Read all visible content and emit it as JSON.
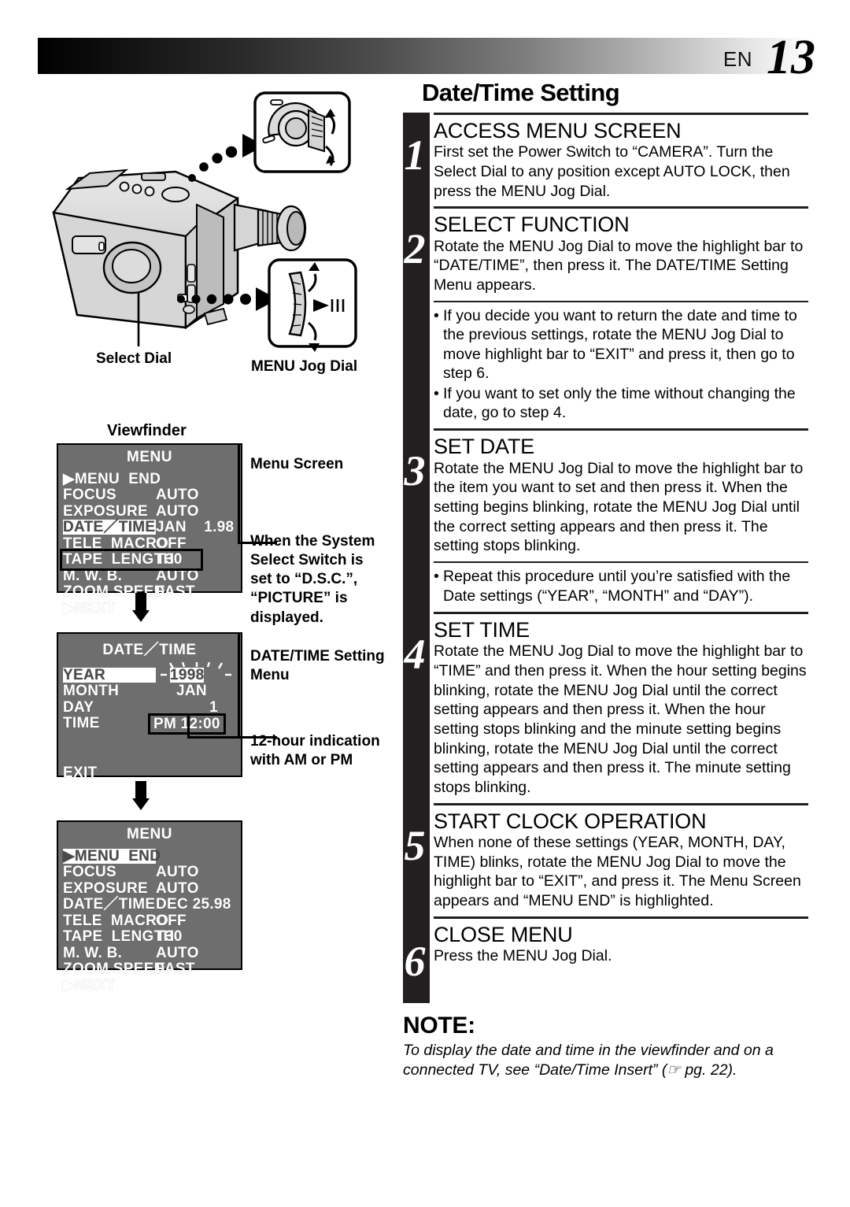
{
  "header": {
    "lang": "EN",
    "page_number": "13"
  },
  "page_title": "Date/Time Setting",
  "camera_labels": {
    "select_dial": "Select Dial",
    "menu_jog_dial": "MENU Jog Dial",
    "viewfinder": "Viewfinder"
  },
  "screens": {
    "menu_screen_1": {
      "caption": "MENU",
      "rows": [
        {
          "key": "▶MENU  END",
          "value": ""
        },
        {
          "key": "FOCUS",
          "value": "AUTO"
        },
        {
          "key": "EXPOSURE",
          "value": "AUTO"
        },
        {
          "key": "DATE／TIME",
          "value": "JAN    1.98"
        },
        {
          "key": "TELE  MACRO",
          "value": "OFF"
        },
        {
          "key": "TAPE  LENGTH",
          "value": "T30"
        },
        {
          "key": "M. W. B.",
          "value": "AUTO"
        },
        {
          "key": "ZOOM SPEED",
          "value": "FAST"
        },
        {
          "key": "▶NEXT",
          "value": ""
        }
      ]
    },
    "date_time_menu": {
      "caption": "DATE／TIME",
      "rows": [
        {
          "key": "YEAR",
          "value": "1998"
        },
        {
          "key": "MONTH",
          "value": "JAN"
        },
        {
          "key": "DAY",
          "value": "1"
        },
        {
          "key": "TIME",
          "value": "PM 12:00"
        }
      ],
      "exit": "EXIT"
    },
    "menu_screen_2": {
      "caption": "MENU",
      "rows": [
        {
          "key": "▶MENU  END",
          "value": ""
        },
        {
          "key": "FOCUS",
          "value": "AUTO"
        },
        {
          "key": "EXPOSURE",
          "value": "AUTO"
        },
        {
          "key": "DATE／TIME",
          "value": "DEC 25.98"
        },
        {
          "key": "TELE  MACRO",
          "value": "OFF"
        },
        {
          "key": "TAPE  LENGTH",
          "value": "T30"
        },
        {
          "key": "M. W. B.",
          "value": "AUTO"
        },
        {
          "key": "ZOOM SPEED",
          "value": "FAST"
        },
        {
          "key": "▶NEXT",
          "value": ""
        }
      ]
    }
  },
  "callouts": {
    "menu_screen": "Menu Screen",
    "system_select": "When the System Select Switch is set to “D.S.C.”, “PICTURE” is displayed.",
    "datetime_setting_menu": "DATE/TIME Setting Menu",
    "twelve_hour": "12-hour indication with AM or PM"
  },
  "steps": [
    {
      "num": "1",
      "heading": "ACCESS MENU SCREEN",
      "body": "First set the Power Switch to “CAMERA”. Turn the Select Dial to any position except AUTO LOCK, then press the MENU Jog Dial.",
      "bullets": []
    },
    {
      "num": "2",
      "heading": "SELECT FUNCTION",
      "body": "Rotate the MENU Jog Dial to move the highlight bar to “DATE/TIME”, then press it. The DATE/TIME Setting Menu appears.",
      "bullets": [
        "If you decide you want to return the date and time to the previous settings, rotate the MENU Jog Dial to move highlight bar to “EXIT” and press it, then go to step 6.",
        "If you want to set only the time without changing the date, go to step 4."
      ]
    },
    {
      "num": "3",
      "heading": "SET DATE",
      "body": "Rotate the MENU Jog Dial to move the highlight bar to the item you want to set and then press it. When the setting begins blinking, rotate the MENU Jog Dial until the correct setting appears and then press it. The setting stops blinking.",
      "bullets": [
        "Repeat this procedure until you’re satisfied with the Date settings (“YEAR”, “MONTH” and “DAY”)."
      ]
    },
    {
      "num": "4",
      "heading": "SET TIME",
      "body": "Rotate the MENU Jog Dial to move the highlight bar to “TIME” and then press it. When the hour setting begins blinking, rotate the MENU Jog Dial until the correct setting appears and then press it. When the hour setting stops blinking and the minute setting begins blinking, rotate the MENU Jog Dial until the correct setting appears and then press it. The minute setting stops blinking.",
      "bullets": []
    },
    {
      "num": "5",
      "heading": "START CLOCK OPERATION",
      "body": "When none of these settings (YEAR, MONTH, DAY, TIME) blinks, rotate the MENU Jog Dial to move the highlight bar to “EXIT”, and press it. The Menu Screen appears and “MENU END” is highlighted.",
      "bullets": []
    },
    {
      "num": "6",
      "heading": "CLOSE MENU",
      "body": "Press the MENU Jog Dial.",
      "bullets": []
    }
  ],
  "note": {
    "heading": "NOTE:",
    "body": "To display the date and time in the viewfinder and on a connected TV, see “Date/Time Insert” (☞ pg. 22)."
  }
}
